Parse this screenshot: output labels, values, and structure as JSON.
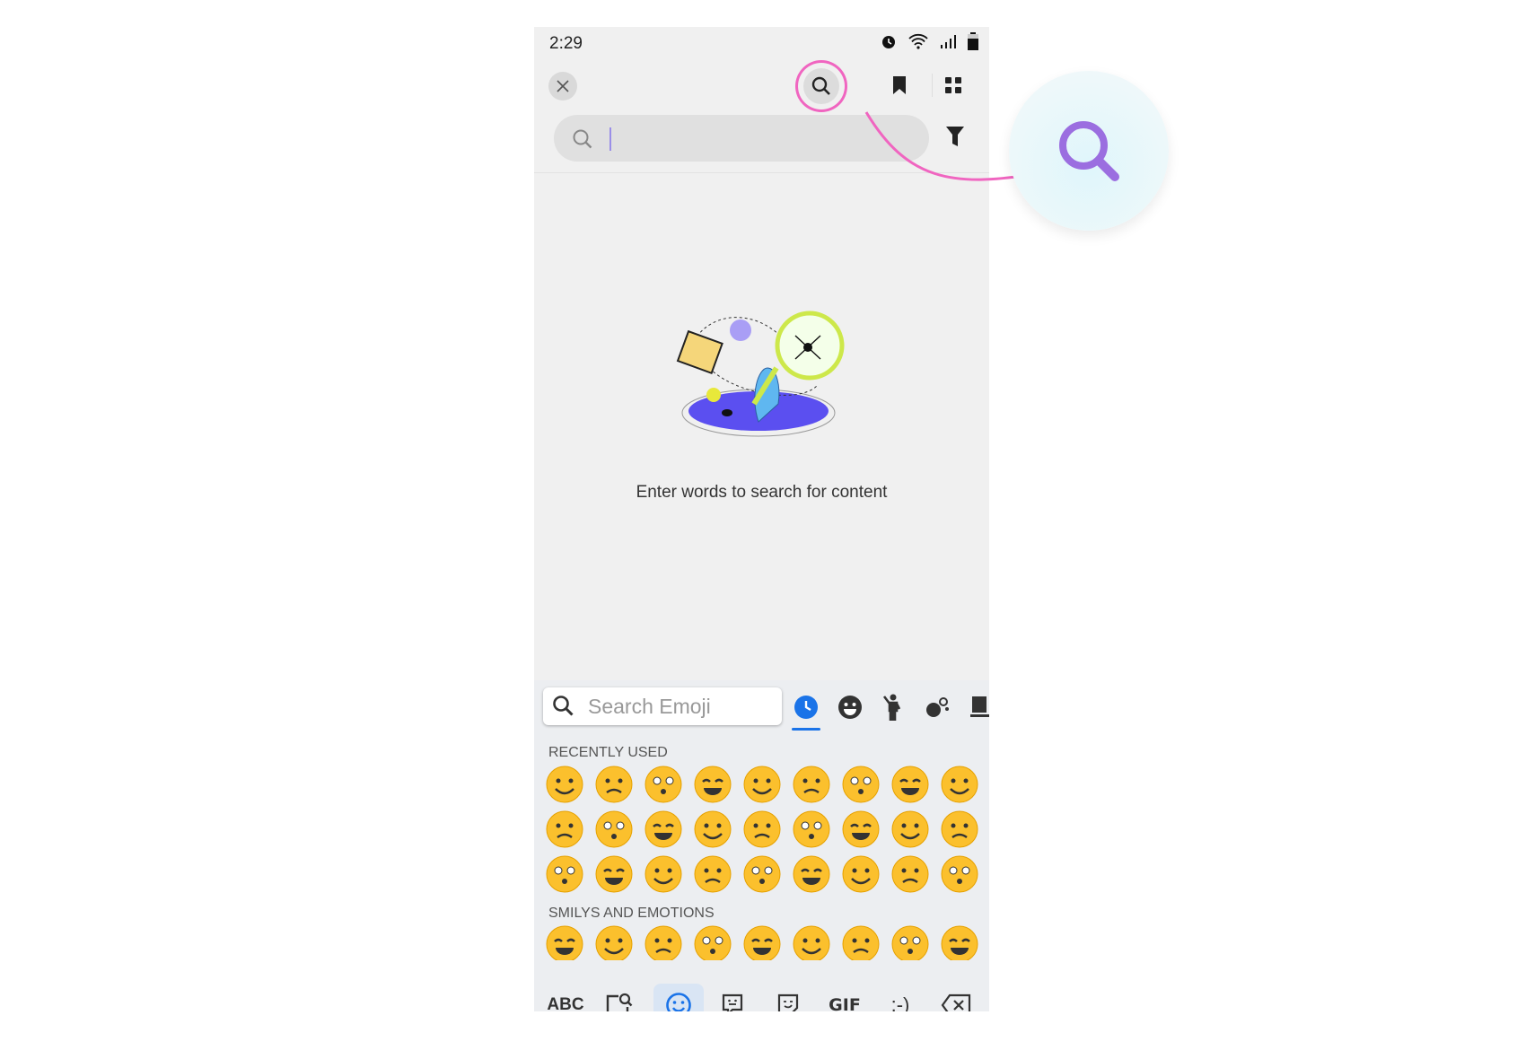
{
  "status_bar": {
    "time": "2:29",
    "icons": [
      "alarm-icon",
      "wifi-icon",
      "signal-icon",
      "battery-icon"
    ]
  },
  "toolbar": {
    "icons": [
      "close-icon",
      "search-icon",
      "bookmark-icon",
      "grid-icon"
    ]
  },
  "search": {
    "value": "",
    "icons": [
      "search-icon",
      "filter-icon"
    ]
  },
  "empty_state": {
    "message": "Enter words to search for content"
  },
  "keyboard": {
    "search_placeholder": "Search Emoji",
    "tabs": [
      "recent-icon",
      "smiley-icon",
      "people-icon",
      "nature-icon",
      "objects-icon"
    ],
    "active_tab": "recent",
    "sections": [
      {
        "title": "RECENTLY USED"
      },
      {
        "title": "SMILYS AND EMOTIONS"
      }
    ],
    "bottom": {
      "abc": "ABC",
      "gif": "GIF",
      "emoticon": ":-)",
      "icons": [
        "clipboard-search-icon",
        "emoji-icon",
        "sticker-icon",
        "bitmoji-icon",
        "backspace-icon"
      ]
    }
  },
  "colors": {
    "accent": "#1a73e8",
    "highlight": "#f065c0",
    "magnifier": "#9b6ee0",
    "emoji": "#fbc02d"
  }
}
